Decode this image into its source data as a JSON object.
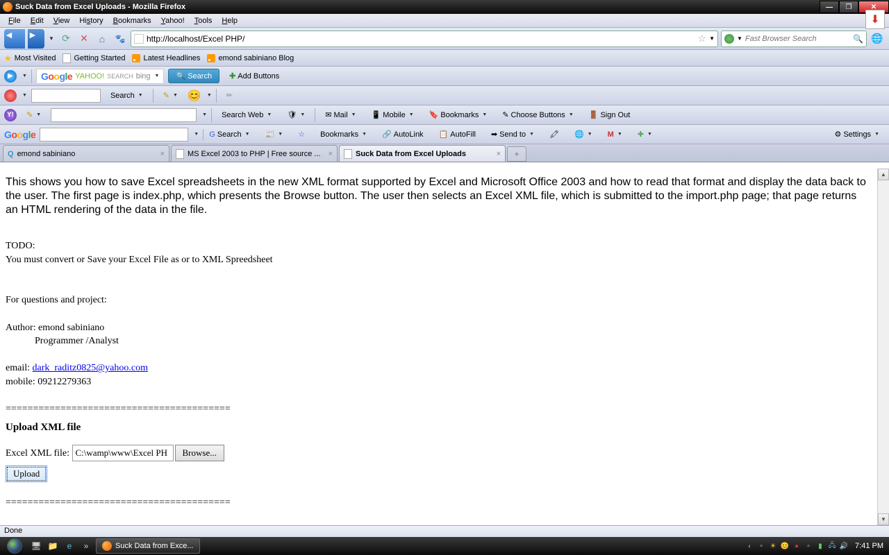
{
  "window": {
    "title": "Suck Data from Excel Uploads - Mozilla Firefox"
  },
  "menu": {
    "file": "File",
    "edit": "Edit",
    "view": "View",
    "history": "History",
    "bookmarks": "Bookmarks",
    "yahoo": "Yahoo!",
    "tools": "Tools",
    "help": "Help"
  },
  "nav": {
    "url": "http://localhost/Excel PHP/",
    "search_placeholder": "Fast Browser Search"
  },
  "bookmarks_bar": {
    "most_visited": "Most Visited",
    "getting_started": "Getting Started",
    "latest_headlines": "Latest Headlines",
    "emond_blog": "emond sabiniano Blog"
  },
  "tb1": {
    "search": "Search",
    "search_btn": "Search",
    "add_buttons": "Add Buttons"
  },
  "tb2": {
    "search": "Search"
  },
  "tb3": {
    "search_web": "Search Web",
    "mail": "Mail",
    "mobile": "Mobile",
    "bookmarks": "Bookmarks",
    "choose_buttons": "Choose Buttons",
    "sign_out": "Sign Out"
  },
  "tb4": {
    "search": "Search",
    "bookmarks": "Bookmarks",
    "autolink": "AutoLink",
    "autofill": "AutoFill",
    "send_to": "Send to",
    "settings": "Settings"
  },
  "tabs": [
    {
      "title": "emond sabiniano"
    },
    {
      "title": "MS Excel 2003 to PHP | Free source ..."
    },
    {
      "title": "Suck Data from Excel Uploads"
    }
  ],
  "page": {
    "intro": "This shows you how to save Excel spreadsheets in the new XML format supported by Excel and Microsoft Office 2003 and how to read that format and display the data back to the user.  The first page is index.php, which presents the Browse button. The user then selects an Excel XML file, which is submitted to the import.php page; that page returns an HTML rendering of the data in the file.",
    "todo_label": "TODO:",
    "todo_text": "You must convert or Save your Excel File as or to XML Spreedsheet",
    "for_questions": "For  questions and project:",
    "author_line": "Author: emond sabiniano",
    "author_role": "            Programmer /Analyst",
    "email_label": "email:   ",
    "email_link": "dark_raditz0825@yahoo.com",
    "mobile": "mobile: 09212279363",
    "divider": "=========================================",
    "upload_header": "Upload XML file",
    "file_label": "Excel XML file: ",
    "file_value": "C:\\wamp\\www\\Excel PH",
    "browse": "Browse...",
    "upload": "Upload"
  },
  "status": {
    "text": "Done"
  },
  "taskbar": {
    "active": "Suck Data from Exce...",
    "time": "7:41 PM"
  }
}
